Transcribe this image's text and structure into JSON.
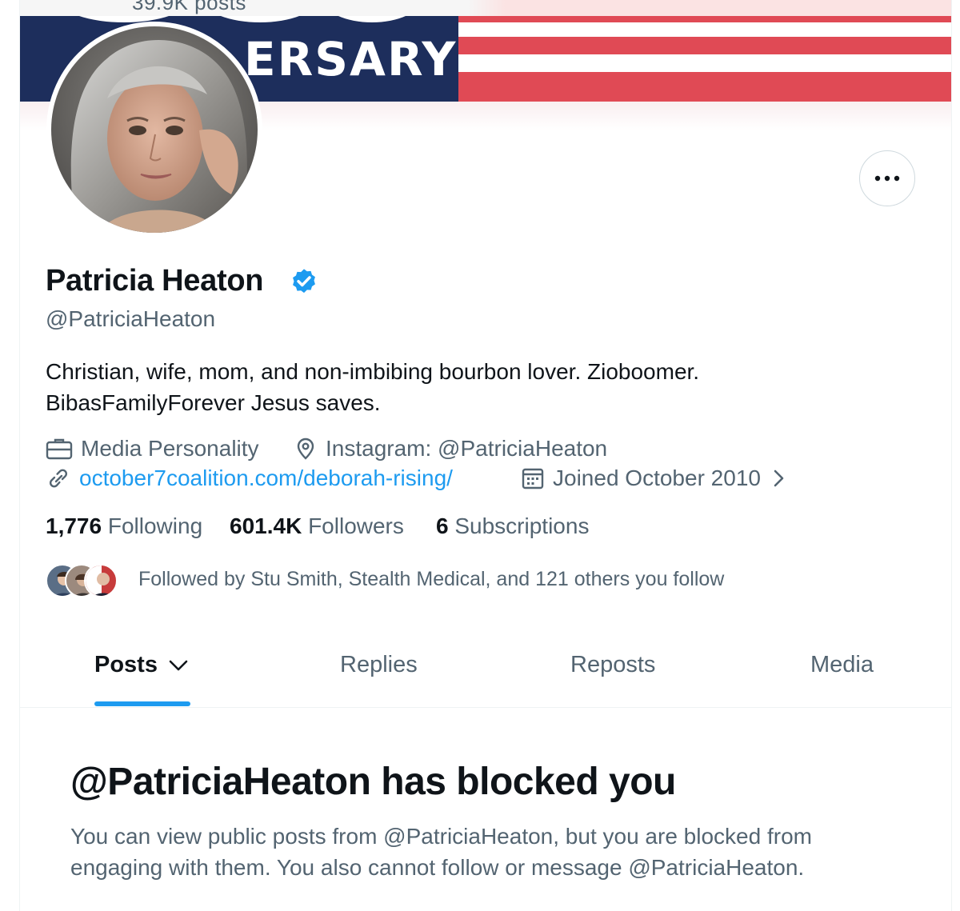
{
  "header": {
    "posts_count": "39.9K posts"
  },
  "banner": {
    "text": "ERSARY",
    "colors": {
      "navy": "#1d2e5c",
      "flag_red": "#e04a55",
      "flag_white": "#ffffff"
    }
  },
  "profile": {
    "name": "Patricia Heaton",
    "verified": true,
    "handle": "@PatriciaHeaton",
    "bio_line1": "Christian, wife, mom, and non-imbibing bourbon lover. Zioboomer.",
    "bio_line2": "BibasFamilyForever Jesus saves.",
    "category": "Media Personality",
    "location": "Instagram: @PatriciaHeaton",
    "website": "october7coalition.com/deborah-rising/",
    "joined": "Joined October 2010"
  },
  "stats": {
    "following_count": "1,776",
    "following_label": "Following",
    "followers_count": "601.4K",
    "followers_label": "Followers",
    "subscriptions_count": "6",
    "subscriptions_label": "Subscriptions"
  },
  "followed_by": "Followed by Stu Smith, Stealth Medical, and 121 others you follow",
  "tabs": [
    {
      "label": "Posts",
      "active": true
    },
    {
      "label": "Replies",
      "active": false
    },
    {
      "label": "Reposts",
      "active": false
    },
    {
      "label": "Media",
      "active": false
    }
  ],
  "blocked": {
    "title": "@PatriciaHeaton has blocked you",
    "message": "You can view public posts from @PatriciaHeaton, but you are blocked from engaging with them. You also cannot follow or message @PatriciaHeaton."
  },
  "icons": {
    "more": "more-horizontal-icon",
    "verified": "verified-badge-icon",
    "category": "briefcase-icon",
    "location": "location-pin-icon",
    "website": "link-icon",
    "joined": "calendar-icon",
    "joined_chevron": "chevron-right-icon",
    "posts_dropdown": "chevron-down-icon"
  },
  "theme": {
    "accent": "#1d9bf0",
    "text": "#0f1419",
    "muted": "#536471",
    "border": "#cfd9de"
  }
}
